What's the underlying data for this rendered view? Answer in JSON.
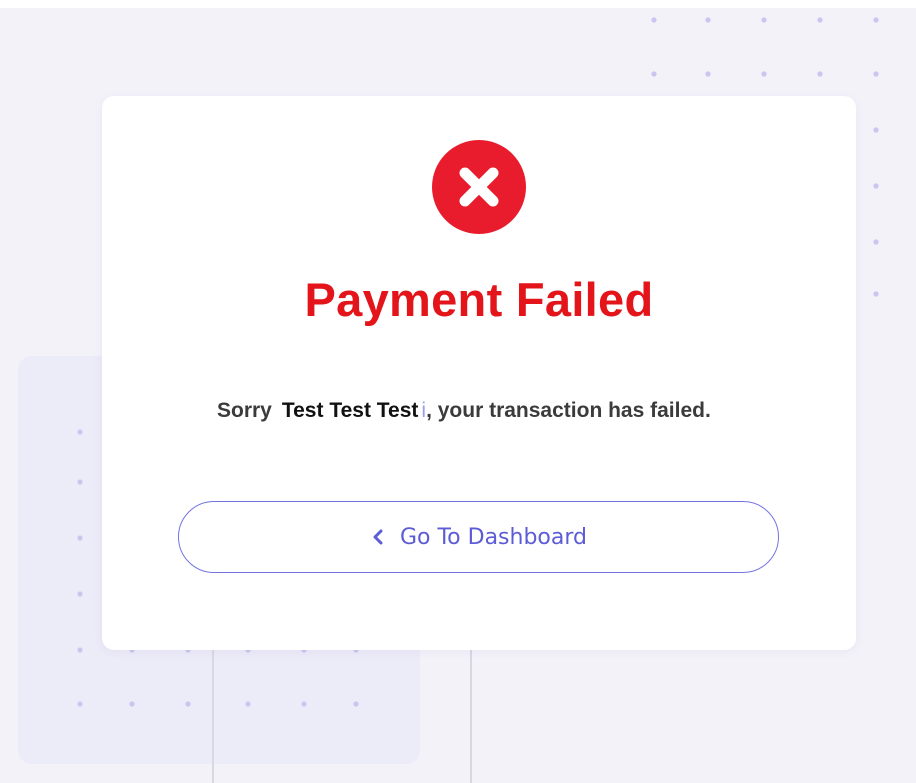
{
  "status": {
    "icon": "error-x-circle-icon",
    "title": "Payment Failed",
    "message": {
      "prefix": "Sorry",
      "name": "Test Test Test",
      "mark": "i",
      "suffix": ", your transaction has failed."
    }
  },
  "actions": {
    "dashboard": {
      "icon": "chevron-left-icon",
      "label": "Go To Dashboard"
    }
  },
  "colors": {
    "background": "#f3f2f9",
    "card": "#ffffff",
    "error": "#e3151a",
    "accent": "#5c5cd6",
    "dots": "#c9c7ef"
  }
}
